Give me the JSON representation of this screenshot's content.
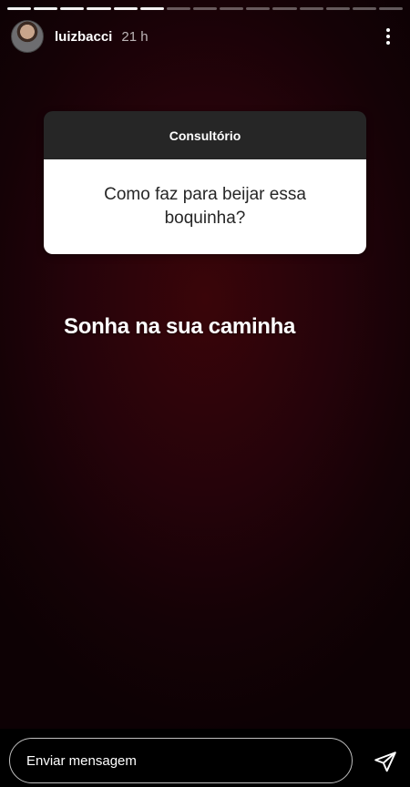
{
  "story": {
    "segments_total": 15,
    "segments_viewed": 6,
    "background_color": "#2a0409"
  },
  "header": {
    "username": "luizbacci",
    "time": "21 h",
    "avatar_icon": "profile-photo",
    "more_icon": "more-vertical-icon"
  },
  "question_sticker": {
    "title": "Consultório",
    "question": "Como faz para beijar essa boquinha?"
  },
  "answer_text": "Sonha na sua caminha",
  "footer": {
    "message_placeholder": "Enviar mensagem",
    "send_icon": "send-icon"
  }
}
